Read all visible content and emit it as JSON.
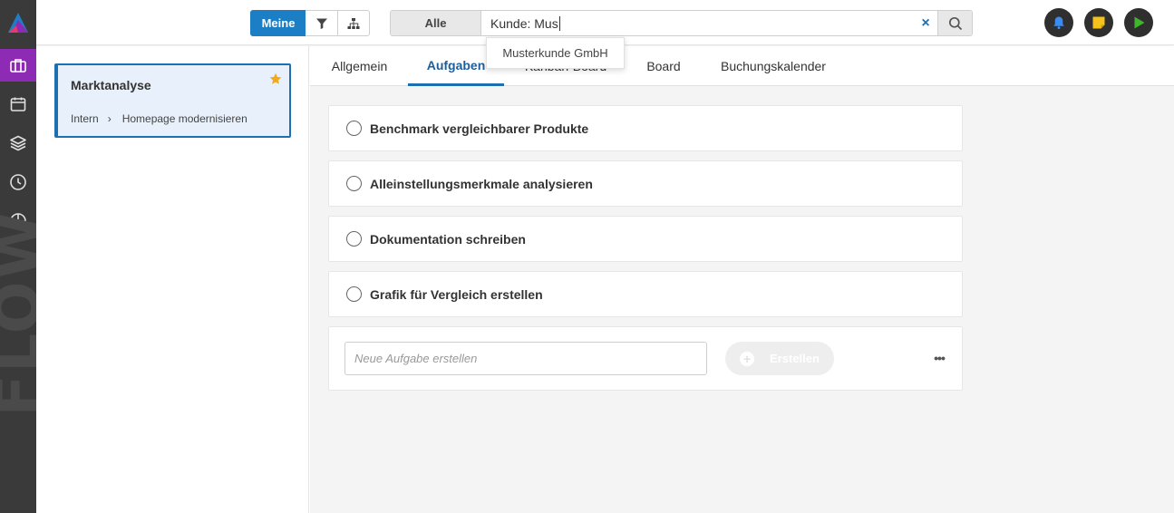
{
  "watermark": "FLOW",
  "rail": {
    "items": [
      {
        "icon": "briefcase-icon",
        "active": true
      },
      {
        "icon": "calendar-icon",
        "active": false
      },
      {
        "icon": "layers-icon",
        "active": false
      },
      {
        "icon": "clock-icon",
        "active": false
      },
      {
        "icon": "pie-chart-icon",
        "active": false
      }
    ],
    "active_color": "#8e2bb4"
  },
  "toolbar": {
    "meine_label": "Meine"
  },
  "search": {
    "scope_label": "Alle",
    "value": "Kunde: Mus",
    "clear_label": "×"
  },
  "autocomplete": {
    "suggestion": "Musterkunde GmbH"
  },
  "project_card": {
    "title": "Marktanalyse",
    "breadcrumb_parent": "Intern",
    "breadcrumb_child": "Homepage modernisieren"
  },
  "tabs": [
    {
      "label": "Allgemein",
      "active": false
    },
    {
      "label": "Aufgaben",
      "active": true
    },
    {
      "label": "Kanban-Board",
      "active": false
    },
    {
      "label": "Board",
      "active": false
    },
    {
      "label": "Buchungskalender",
      "active": false
    }
  ],
  "tasks": [
    {
      "label": "Benchmark vergleichbarer Produkte"
    },
    {
      "label": "Alleinstellungsmerkmale analysieren"
    },
    {
      "label": "Dokumentation schreiben"
    },
    {
      "label": "Grafik für Vergleich erstellen"
    }
  ],
  "new_task": {
    "placeholder": "Neue Aufgabe erstellen",
    "create_label": "Erstellen",
    "more_label": "•••"
  },
  "colors": {
    "accent": "#1c7fc6",
    "rail": "#3a3a3a",
    "bell": "#3b8cf0",
    "note": "#f5c21b",
    "play": "#3fb62c"
  }
}
